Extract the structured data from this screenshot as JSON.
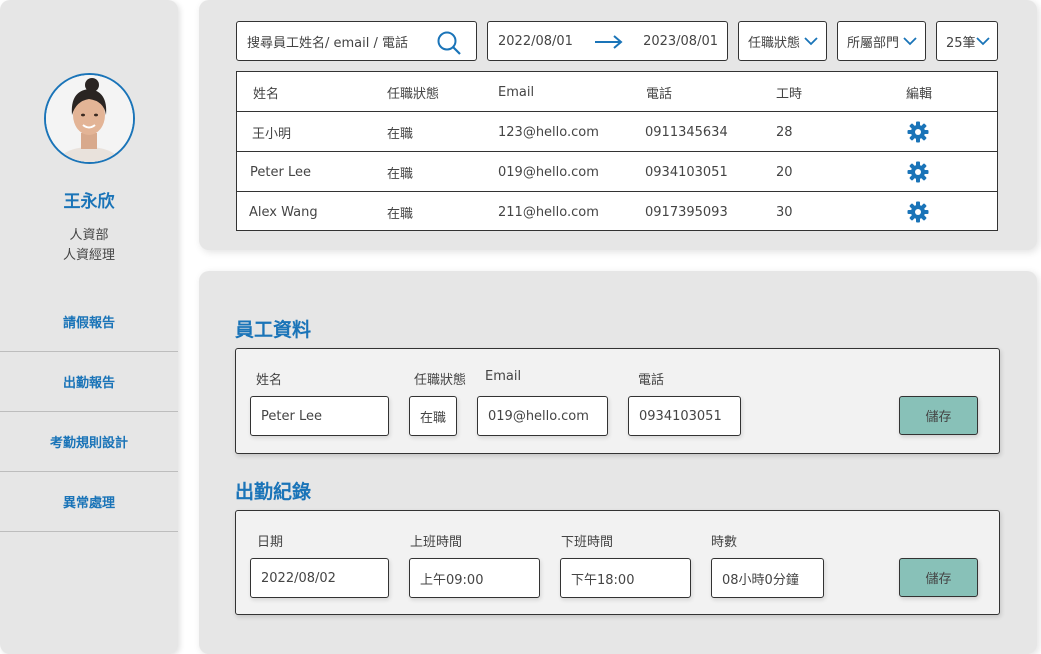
{
  "user": {
    "name": "王永欣",
    "department": "人資部",
    "role": "人資經理"
  },
  "nav": [
    {
      "label": "請假報告"
    },
    {
      "label": "出勤報告"
    },
    {
      "label": "考勤規則設計"
    },
    {
      "label": "異常處理"
    }
  ],
  "filters": {
    "search_placeholder": "搜尋員工姓名/ email / 電話",
    "date_from": "2022/08/01",
    "date_to": "2023/08/01",
    "status": "任職狀態",
    "department": "所屬部門",
    "page_size": "25筆"
  },
  "table": {
    "headers": [
      "姓名",
      "任職狀態",
      "Email",
      "電話",
      "工時",
      "編輯"
    ],
    "rows": [
      [
        "王小明",
        "在職",
        "123@hello.com",
        "0911345634",
        "28"
      ],
      [
        "Peter Lee",
        "在職",
        "019@hello.com",
        "0934103051",
        "20"
      ],
      [
        "Alex Wang",
        "在職",
        "211@hello.com",
        "0917395093",
        "30"
      ]
    ]
  },
  "employee_section": {
    "title": "員工資料",
    "labels": {
      "name": "姓名",
      "status": "任職狀態",
      "email": "Email",
      "phone": "電話"
    },
    "values": {
      "name": "Peter Lee",
      "status": "在職",
      "email": "019@hello.com",
      "phone": "0934103051"
    },
    "save_label": "儲存"
  },
  "attendance_section": {
    "title": "出勤紀錄",
    "labels": {
      "date": "日期",
      "clock_in": "上班時間",
      "clock_out": "下班時間",
      "hours": "時數"
    },
    "values": {
      "date": "2022/08/02",
      "clock_in": "上午09:00",
      "clock_out": "下午18:00",
      "hours": "08小時0分鐘"
    },
    "save_label": "儲存"
  },
  "colors": {
    "accent": "#1a74b8",
    "panel": "#e6e6e6",
    "save_button": "#88c1b8"
  },
  "icons": {
    "search": "search-icon",
    "arrow": "arrow-right-icon",
    "chevron": "chevron-down-icon",
    "edit": "gear-icon"
  }
}
